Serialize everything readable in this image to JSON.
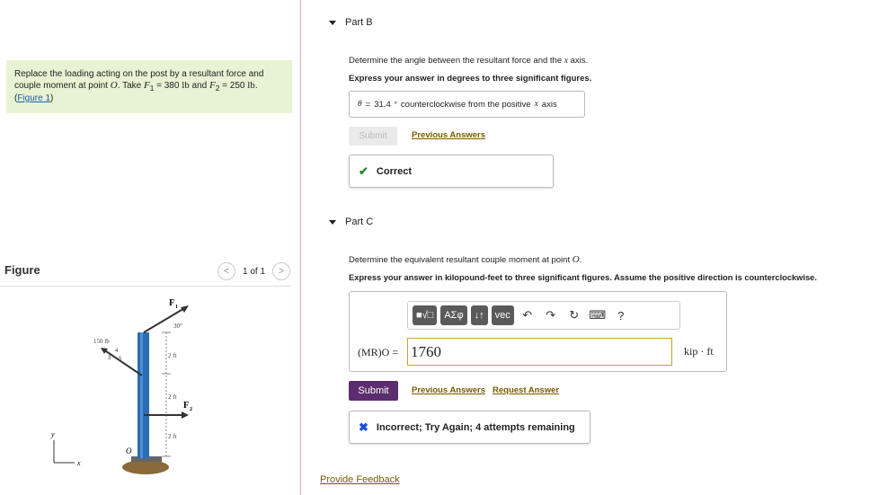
{
  "problem": {
    "text1": "Replace the loading acting on the post by a resultant force and couple moment at point ",
    "point": "O",
    "text2": ". Take ",
    "f1_sym": "F",
    "f1_sub": "1",
    "f1_eq": " = 380 ",
    "unit_lb": "lb",
    "and": " and ",
    "f2_sym": "F",
    "f2_sub": "2",
    "f2_eq": " = 250 ",
    "period": ".",
    "figure_link": "Figure 1",
    "paren_open": "(",
    "paren_close": ")"
  },
  "figure": {
    "title": "Figure",
    "pager": "1 of 1",
    "prev": "<",
    "next": ">",
    "labels": {
      "f1": "F",
      "f1_sub": "1",
      "f2": "F",
      "f2_sub": "2",
      "angle": "30°",
      "load": "150 lb",
      "ratio3": "3",
      "ratio4": "4",
      "ratio5": "5",
      "dim1": "2 ft",
      "dim2": "2 ft",
      "dim3": "2 ft",
      "origin": "O",
      "y": "y",
      "x": "x"
    }
  },
  "partB": {
    "title_partial": "Part B",
    "question_pre": "Determine the angle between the resultant force and the ",
    "question_var": "x",
    "question_post": " axis.",
    "instruction": "Express your answer in degrees to three significant figures.",
    "answer_theta": "θ",
    "answer_eq": " = ",
    "answer_value": "31.4",
    "answer_deg": "°",
    "answer_desc_pre": "counterclockwise from the positive ",
    "answer_desc_var": "x",
    "answer_desc_post": " axis",
    "submit": "Submit",
    "previous_answers": "Previous Answers",
    "feedback": "Correct"
  },
  "partC": {
    "title": "Part C",
    "question_pre": "Determine the equivalent resultant couple moment at point ",
    "question_var": "O",
    "question_post": ".",
    "instruction": "Express your answer in kilopound-feet to three significant figures. Assume the positive direction is counterclockwise.",
    "toolbar": {
      "templates": "■√□",
      "symbols": "AΣφ",
      "arrows": "↓↑",
      "vec": "vec",
      "undo": "↶",
      "redo": "↷",
      "reset": "↻",
      "keyboard": "⌨",
      "help": "?"
    },
    "eq_label": "(MR)O =",
    "input_value": "1760",
    "unit": "kip · ft",
    "submit": "Submit",
    "previous_answers": "Previous Answers",
    "request_answer": "Request Answer",
    "feedback": "Incorrect; Try Again; 4 attempts remaining"
  },
  "footer": {
    "provide_feedback": "Provide Feedback"
  },
  "colors": {
    "problem_bg": "#e8f3d4",
    "submit_bg": "#5b2d6e",
    "link": "#7a5a00",
    "correct": "#2a8a2a",
    "incorrect": "#1d4fd8",
    "post": "#2a6db5"
  }
}
